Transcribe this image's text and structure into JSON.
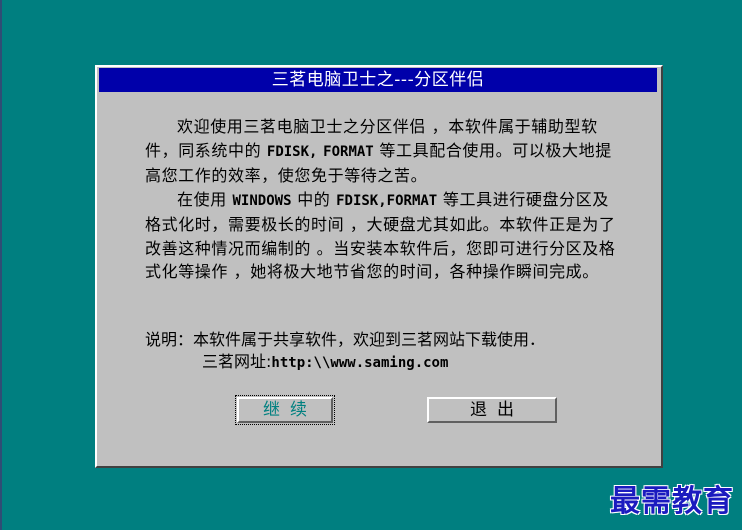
{
  "dialog": {
    "title": "三茗电脑卫士之---分区伴侣",
    "paragraph1": {
      "part1": "欢迎使用三茗电脑卫士之分区伴侣 ，本软件属于辅助型软件，同系统中的 ",
      "fdisk": "FDISK,",
      "part2": " ",
      "format": "FORMAT",
      "part3": " 等工具配合使用。可以极大地提高您工作的效率，使您免于等待之苦。"
    },
    "paragraph2": {
      "part1": "在使用 ",
      "windows": "WINDOWS",
      "part2": " 中的 ",
      "tools": "FDISK,FORMAT",
      "part3": " 等工具进行硬盘分区及格式化时，需要极长的时间 ，大硬盘尤其如此。本软件正是为了改善这种情况而编制的 。当安装本软件后，您即可进行分区及格式化等操作 ，她将极大地节省您的时间，各种操作瞬间完成。"
    },
    "note": {
      "label": "说明：",
      "text": "本软件属于共享软件，欢迎到三茗网站下载使用．"
    },
    "site": {
      "label": "三茗网址:",
      "url": "http:\\\\www.saming.com"
    },
    "buttons": {
      "continue": "继续",
      "exit": "退出"
    }
  },
  "watermark": "最需教育"
}
